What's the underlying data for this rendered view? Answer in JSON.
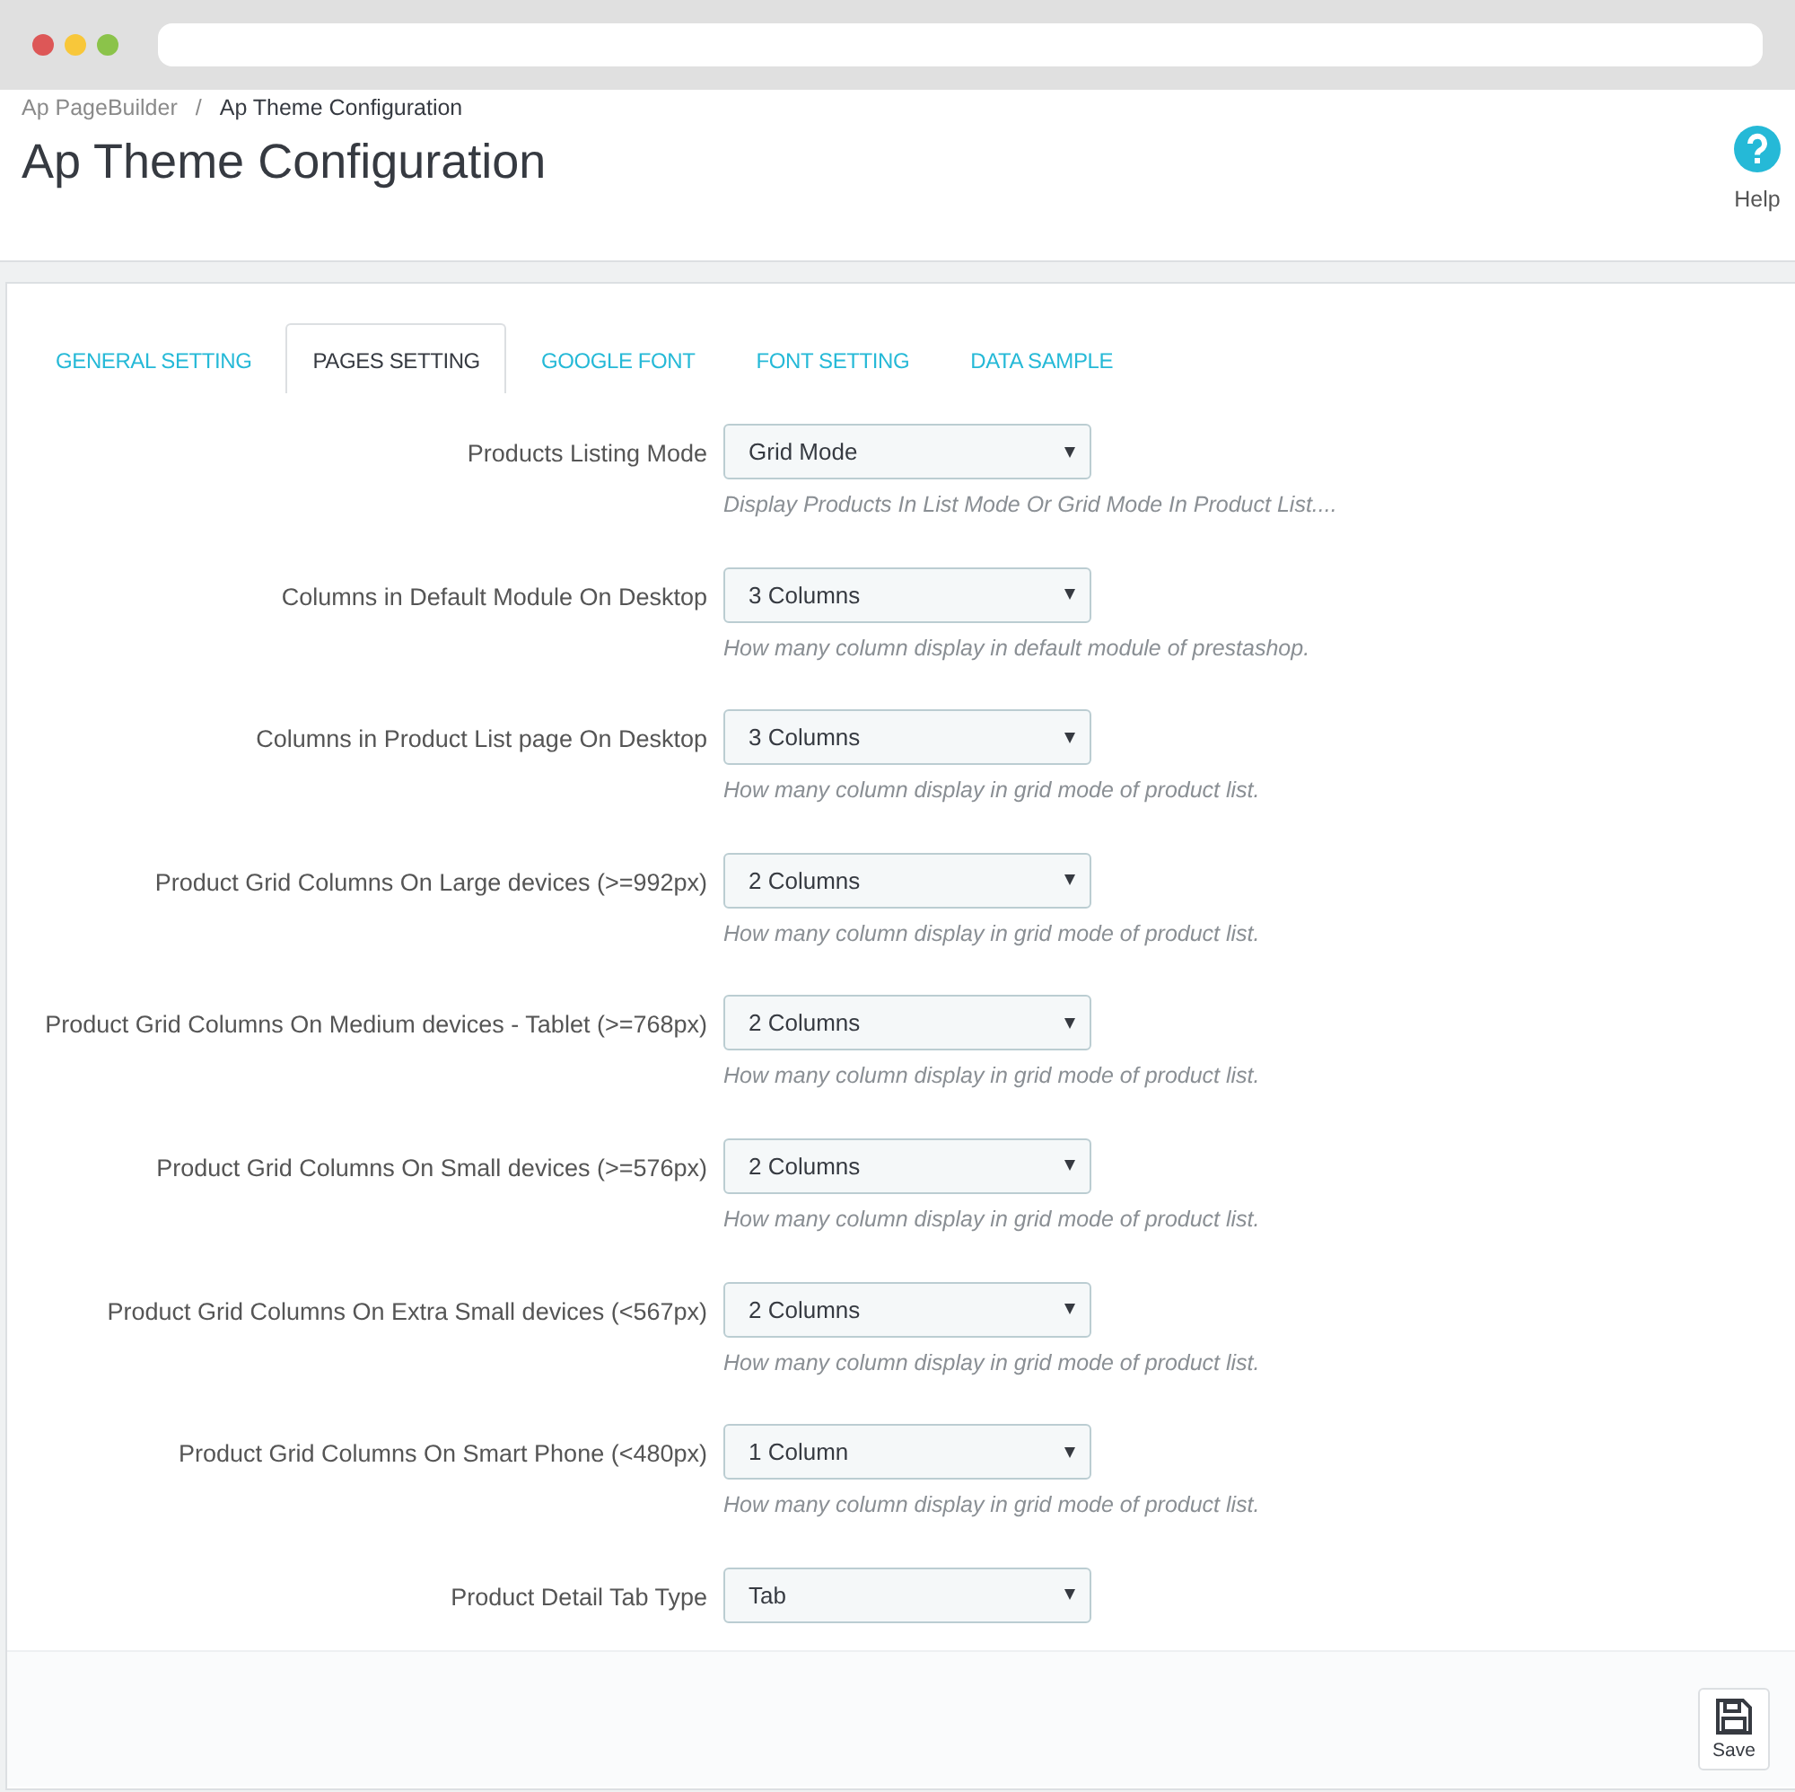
{
  "breadcrumb": [
    "Ap PageBuilder",
    "Ap Theme Configuration"
  ],
  "breadcrumb_separator": "/",
  "title": "Ap Theme Configuration",
  "help": "Help",
  "tabs": [
    {
      "label": "GENERAL SETTING",
      "selected": false
    },
    {
      "label": "PAGES SETTING",
      "selected": true
    },
    {
      "label": "GOOGLE FONT",
      "selected": false
    },
    {
      "label": "FONT SETTING",
      "selected": false
    },
    {
      "label": "DATA SAMPLE",
      "selected": false
    }
  ],
  "fields": [
    {
      "label": "Products Listing Mode",
      "value": "Grid Mode",
      "help": "Display Products In List Mode Or Grid Mode In Product List...."
    },
    {
      "label": "Columns in Default Module On Desktop",
      "value": "3 Columns",
      "help": "How many column display in default module of prestashop."
    },
    {
      "label": "Columns in Product List page On Desktop",
      "value": "3 Columns",
      "help": "How many column display in grid mode of product list."
    },
    {
      "label": "Product Grid Columns On Large devices (>=992px)",
      "value": "2 Columns",
      "help": "How many column display in grid mode of product list."
    },
    {
      "label": "Product Grid Columns On Medium devices - Tablet (>=768px)",
      "value": "2 Columns",
      "help": "How many column display in grid mode of product list."
    },
    {
      "label": "Product Grid Columns On Small devices (>=576px)",
      "value": "2 Columns",
      "help": "How many column display in grid mode of product list."
    },
    {
      "label": "Product Grid Columns On Extra Small devices (<567px)",
      "value": "2 Columns",
      "help": "How many column display in grid mode of product list."
    },
    {
      "label": "Product Grid Columns On Smart Phone (<480px)",
      "value": "1 Column",
      "help": "How many column display in grid mode of product list."
    },
    {
      "label": "Product Detail Tab Type",
      "value": "Tab"
    }
  ],
  "save": "Save"
}
